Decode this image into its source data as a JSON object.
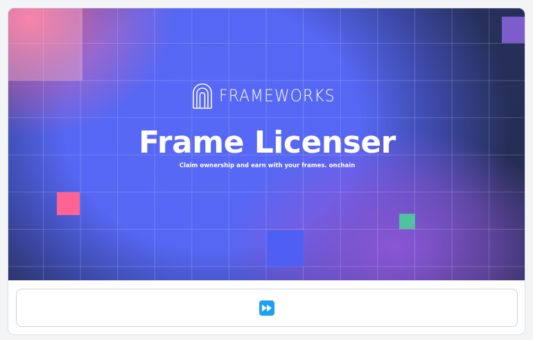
{
  "hero": {
    "brand_name": "FRAMEWORKS",
    "title": "Frame Licenser",
    "subtitle": "Claim ownership and earn with your frames. onchain",
    "logo_icon": "frameworks-arch-logo-icon"
  },
  "action": {
    "icon": "fast-forward-icon",
    "icon_color": "#1da1f2"
  },
  "colors": {
    "hero_blue": "#5668f6",
    "hero_dark": "#232b4d",
    "accent_pink": "#ff6392",
    "accent_green": "#4fc2a0",
    "accent_purple": "#7d5ccb"
  }
}
